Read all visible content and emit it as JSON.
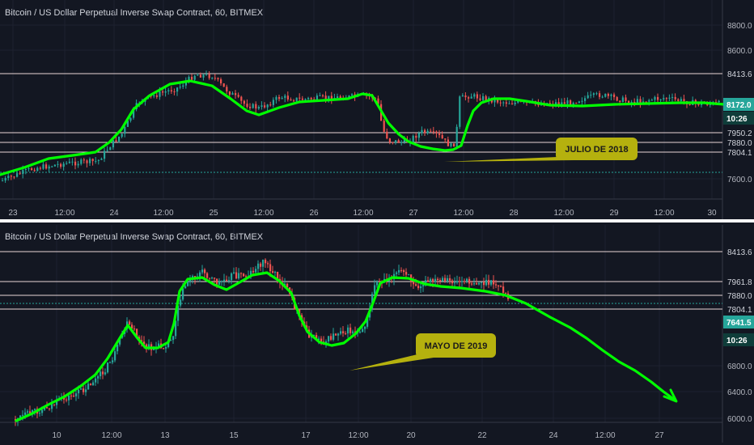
{
  "colors": {
    "background": "#131722",
    "grid": "#1e2230",
    "axis_text": "#b2b5be",
    "candle_up": "#26a69a",
    "candle_down": "#ef5350",
    "trend_line": "#00ff00",
    "hline": "#e8d6d6",
    "dotted_line": "#26a69a",
    "callout_fill": "#b5b10e",
    "separator": "#ffffff"
  },
  "panels": [
    {
      "title": "Bitcoin / US Dollar Perpetual Inverse Swap Contract, 60, BITMEX",
      "annotation": "JULIO DE 2018",
      "x_labels": [
        "23",
        "12:00",
        "24",
        "12:00",
        "25",
        "12:00",
        "26",
        "12:00",
        "27",
        "12:00",
        "28",
        "12:00",
        "29",
        "12:00",
        "30"
      ],
      "y_ticks": [
        "8800.0",
        "8600.0",
        "7600.0"
      ],
      "levels": [
        {
          "label": "8413.6",
          "value": 8413.6
        },
        {
          "label": "7950.2",
          "value": 7950.2
        },
        {
          "label": "7880.0",
          "value": 7880.0
        },
        {
          "label": "7804.1",
          "value": 7804.1
        }
      ],
      "price_tag": "8172.0",
      "time_tag": "10:26",
      "dotted_level": 7680
    },
    {
      "title": "Bitcoin / US Dollar Perpetual Inverse Swap Contract, 60, BITMEX",
      "annotation": "MAYO DE 2019",
      "x_labels": [
        "10",
        "12:00",
        "13",
        "15",
        "17",
        "12:00",
        "20",
        "22",
        "24",
        "12:00",
        "27"
      ],
      "y_ticks": [
        "6800.0",
        "6400.0",
        "6000.0"
      ],
      "levels": [
        {
          "label": "8413.6",
          "value": 8413.6
        },
        {
          "label": "7961.8",
          "value": 7961.8
        },
        {
          "label": "7880.0",
          "value": 7880.0
        },
        {
          "label": "7804.1",
          "value": 7804.1
        }
      ],
      "price_tag": "7641.5",
      "time_tag": "10:26",
      "dotted_level": 7790
    }
  ]
}
